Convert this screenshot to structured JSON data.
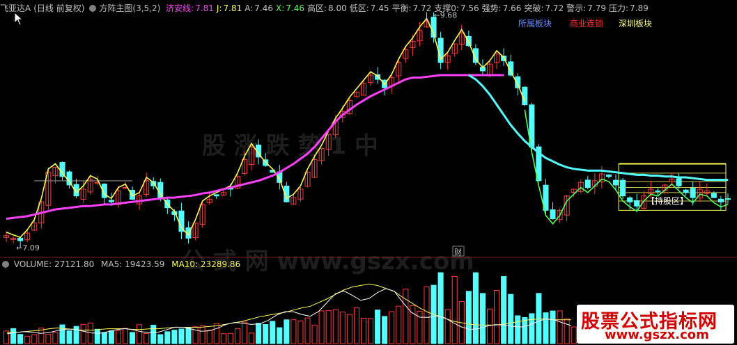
{
  "header": {
    "stock_name": "飞亚达A",
    "period": "(日线 前复权)",
    "indicator_name": "方阵主图(3,5,2)",
    "values": [
      {
        "label": "济安线:",
        "value": "7.81",
        "color": "#ff40ff"
      },
      {
        "label": "J:",
        "value": "7.81",
        "color": "#ffff54"
      },
      {
        "label": "A:",
        "value": "7.46",
        "color": "#c0c0c0"
      },
      {
        "label": "X:",
        "value": "7.46",
        "color": "#54ff54"
      },
      {
        "label": "高区:",
        "value": "8.00",
        "color": "#c0c0c0"
      },
      {
        "label": "低区:",
        "value": "7.45",
        "color": "#c0c0c0"
      },
      {
        "label": "平衡:",
        "value": "7.72",
        "color": "#c0c0c0"
      },
      {
        "label": "支撑0:",
        "value": "7.56",
        "color": "#c0c0c0"
      },
      {
        "label": "强势:",
        "value": "7.66",
        "color": "#c0c0c0"
      },
      {
        "label": "突破:",
        "value": "7.72",
        "color": "#c0c0c0"
      },
      {
        "label": "警示:",
        "value": "7.79",
        "color": "#c0c0c0"
      },
      {
        "label": "压力:",
        "value": "7.89",
        "color": "#c0c0c0"
      }
    ]
  },
  "sectors": [
    {
      "label": "所属板块",
      "color": "#5f8cff"
    },
    {
      "label": "商业连锁",
      "color": "#ff3030"
    },
    {
      "label": "深圳板块",
      "color": "#ffff80"
    }
  ],
  "annotations": {
    "high_price": "9.68",
    "low_price": "7.09",
    "holding_zone": "【持股区】",
    "fin_badge": "财"
  },
  "watermark": {
    "line1": "股 涨 跌 势 1 中",
    "line2": "公 式 网 www.gszx.com"
  },
  "volume_header": {
    "label": "VOLUME:",
    "volume": "27121.80",
    "ma5_label": "MA5:",
    "ma5": "19423.59",
    "ma10_label": "MA10:",
    "ma10": "23289.86",
    "ma10_color": "#ffff54"
  },
  "logo": {
    "text": "股票公式指标网",
    "url": "www.gszx.com"
  },
  "chart_data": {
    "type": "candlestick",
    "ylim": [
      7.0,
      9.75
    ],
    "price_path": [
      7.15,
      7.12,
      7.09,
      7.18,
      7.3,
      7.55,
      7.9,
      7.96,
      7.85,
      7.75,
      7.62,
      7.7,
      7.82,
      7.78,
      7.6,
      7.55,
      7.68,
      7.72,
      7.58,
      7.62,
      7.8,
      7.74,
      7.6,
      7.48,
      7.4,
      7.2,
      7.12,
      7.3,
      7.52,
      7.58,
      7.62,
      7.66,
      7.7,
      7.85,
      8.05,
      8.2,
      8.08,
      7.98,
      7.9,
      7.78,
      7.55,
      7.6,
      7.7,
      7.9,
      8.05,
      8.18,
      8.35,
      8.5,
      8.62,
      8.75,
      8.85,
      8.95,
      9.05,
      9.0,
      8.9,
      9.02,
      9.2,
      9.35,
      9.45,
      9.58,
      9.68,
      9.5,
      9.2,
      9.28,
      9.42,
      9.55,
      9.4,
      9.2,
      9.1,
      9.18,
      9.3,
      9.22,
      9.05,
      8.9,
      8.7,
      8.2,
      7.8,
      7.45,
      7.35,
      7.45,
      7.62,
      7.7,
      7.78,
      7.72,
      7.8,
      7.88,
      7.85,
      7.75,
      7.62,
      7.55,
      7.5,
      7.62,
      7.7,
      7.68,
      7.75,
      7.82,
      7.74,
      7.66,
      7.6,
      7.7,
      7.68,
      7.6,
      7.55,
      7.58
    ],
    "ma_purple": [
      7.35,
      7.36,
      7.37,
      7.38,
      7.4,
      7.42,
      7.44,
      7.46,
      7.47,
      7.48,
      7.49,
      7.5,
      7.5,
      7.51,
      7.52,
      7.52,
      7.53,
      7.54,
      7.55,
      7.56,
      7.57,
      7.58,
      7.59,
      7.6,
      7.6,
      7.61,
      7.62,
      7.63,
      7.65,
      7.66,
      7.68,
      7.7,
      7.72,
      7.74,
      7.76,
      7.78,
      7.8,
      7.83,
      7.86,
      7.9,
      7.95,
      8.0,
      8.06,
      8.12,
      8.2,
      8.3,
      8.4,
      8.5,
      8.58,
      8.64,
      8.7,
      8.75,
      8.8,
      8.84,
      8.88,
      8.92,
      8.96,
      9.0,
      9.02,
      9.02,
      9.03,
      9.04,
      9.05,
      9.05,
      9.05,
      9.05,
      9.05,
      9.05,
      9.05,
      9.05,
      9.05,
      9.05
    ],
    "ma_cyan_from_index": 66,
    "ma_cyan": [
      9.05,
      9.0,
      8.92,
      8.82,
      8.7,
      8.58,
      8.46,
      8.36,
      8.27,
      8.2,
      8.13,
      8.07,
      8.03,
      7.99,
      7.96,
      7.94,
      7.93,
      7.92,
      7.92,
      7.92,
      7.91,
      7.9,
      7.89,
      7.88,
      7.87,
      7.87,
      7.86,
      7.86,
      7.85,
      7.85,
      7.84,
      7.84,
      7.83,
      7.82,
      7.81,
      7.81,
      7.81,
      7.81
    ],
    "zone_levels": [
      8.0,
      7.89,
      7.79,
      7.72,
      7.66,
      7.56,
      7.45
    ],
    "volume_ma10_shape": [
      0.15,
      0.15,
      0.16,
      0.17,
      0.18,
      0.2,
      0.21,
      0.2,
      0.19,
      0.18,
      0.18,
      0.19,
      0.2,
      0.2,
      0.2,
      0.19,
      0.19,
      0.2,
      0.2,
      0.21,
      0.22,
      0.22,
      0.22,
      0.22,
      0.23,
      0.24,
      0.26,
      0.28,
      0.3,
      0.33,
      0.36,
      0.38,
      0.4,
      0.42,
      0.45,
      0.48,
      0.5,
      0.55,
      0.6,
      0.66,
      0.72,
      0.76,
      0.78,
      0.8,
      0.78,
      0.74,
      0.7,
      0.62,
      0.55,
      0.48,
      0.42,
      0.38,
      0.34,
      0.3,
      0.28,
      0.26,
      0.25,
      0.25,
      0.25,
      0.26,
      0.28,
      0.3,
      0.32,
      0.33,
      0.33,
      0.32,
      0.32,
      0.32
    ]
  }
}
